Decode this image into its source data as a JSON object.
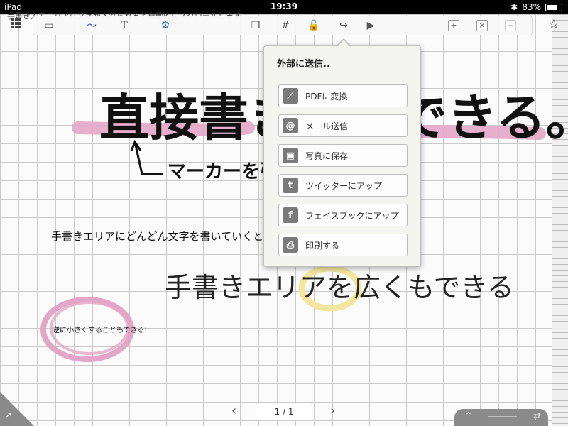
{
  "statusbar": {
    "device": "iPad",
    "time": "19:39",
    "battery": "83%",
    "battery_level": 0.83
  },
  "toolbar": {
    "icons": [
      "grid-menu-icon",
      "keyboard-icon",
      "pen-icon",
      "text-icon",
      "gear-icon",
      "layers-icon",
      "grid-toggle-icon",
      "lock-icon",
      "share-icon",
      "play-icon",
      "add-page-icon",
      "delete-page-icon",
      "minus-page-icon",
      "star-icon"
    ]
  },
  "popup": {
    "title": "外部に送信..",
    "items": [
      {
        "label": "PDFに変換",
        "icon": "pdf-icon"
      },
      {
        "label": "メール送信",
        "icon": "mail-icon"
      },
      {
        "label": "写真に保存",
        "icon": "photo-icon"
      },
      {
        "label": "ツイッターにアップ",
        "icon": "twitter-icon"
      },
      {
        "label": "フェイスブックにアップ",
        "icon": "facebook-icon"
      },
      {
        "label": "印刷する",
        "icon": "print-icon"
      }
    ]
  },
  "pagination": {
    "page": "1 / 1"
  },
  "canvas_text": {
    "top_note": "手書き入力エリアに文字が入れられると自動的にスクロールします",
    "headline": "直接書き込みできる。",
    "marker_note": "マーカーを引",
    "handwrite_small": "手書きエリアにどんどん文字を書いていくと、反映されます。",
    "handwrite_large": "手書きエリアを広くもできる",
    "circle_note": "逆に小さくすることもできる!"
  },
  "colors": {
    "pink": "#e3a6c6",
    "yellow": "#f3e7a0",
    "ink": "#111111"
  }
}
